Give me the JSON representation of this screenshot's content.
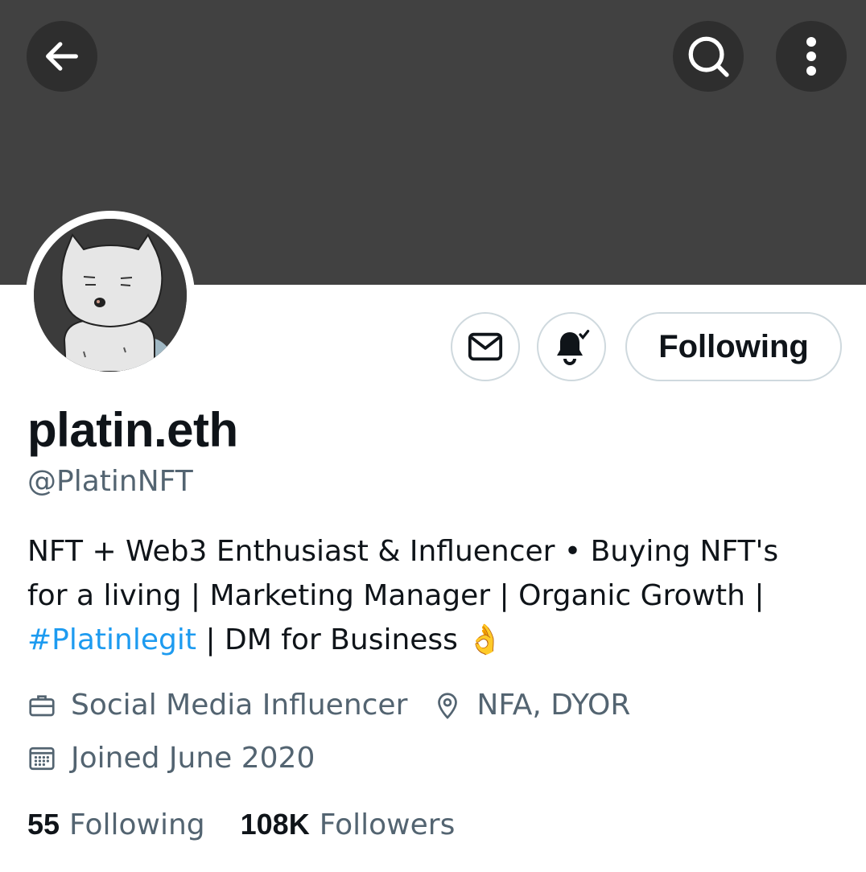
{
  "header": {
    "back_icon": "arrow-left-icon",
    "search_icon": "search-icon",
    "more_icon": "more-vertical-icon",
    "banner_color": "#414141"
  },
  "profile": {
    "display_name": "platin.eth",
    "handle": "@PlatinNFT",
    "bio": {
      "line1": "NFT + Web3 Enthusiast & Influencer • Buying NFT's",
      "line2": "for a living | Marketing Manager | Organic Growth |",
      "hashtag": "#Platinlegit",
      "line3_rest": " | DM for Business ",
      "emoji": "👌"
    },
    "category": "Social Media Influencer",
    "location": "NFA, DYOR",
    "joined": "Joined June 2020"
  },
  "actions": {
    "message_icon": "envelope-icon",
    "notify_icon": "bell-check-icon",
    "following_label": "Following"
  },
  "stats": {
    "following_count": "55",
    "following_label": "Following",
    "followers_count": "108K",
    "followers_label": "Followers"
  },
  "colors": {
    "accent": "#1d9bf0",
    "text_primary": "#0f1419",
    "text_secondary": "#536471"
  }
}
